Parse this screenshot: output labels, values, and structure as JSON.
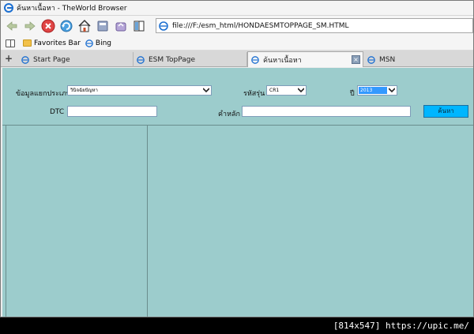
{
  "window": {
    "title": "ค้นหาเนื้อหา - TheWorld Browser"
  },
  "address_bar": {
    "url": "file:///F:/esm_html/HONDAESMTOPPAGE_SM.HTML"
  },
  "favorites_bar": {
    "items": [
      {
        "label": "Favorites Bar",
        "icon": "folder-icon"
      },
      {
        "label": "Bing",
        "icon": "ie-icon"
      }
    ]
  },
  "tabs": [
    {
      "label": "Start Page",
      "active": false
    },
    {
      "label": "ESM TopPage",
      "active": false
    },
    {
      "label": "ค้นหาเนื้อหา",
      "active": true
    },
    {
      "label": "MSN",
      "active": false
    }
  ],
  "form": {
    "category_label": "ข้อมูลแยกประเภท",
    "category_value": "วินิจฉัยปัญหา",
    "model_label": "รหัสรุ่น",
    "model_value": "CR1",
    "year_label": "ปี",
    "year_value": "2013",
    "dtc_label": "DTC",
    "dtc_value": "",
    "keyword_label": "คำหลัก",
    "keyword_value": "",
    "search_label": "ค้นหา"
  },
  "watermark": {
    "text": "[814x547] https://upic.me/"
  },
  "colors": {
    "content_bg": "#9ccccc",
    "search_button": "#00b6ff",
    "year_highlight": "#3399ff"
  }
}
